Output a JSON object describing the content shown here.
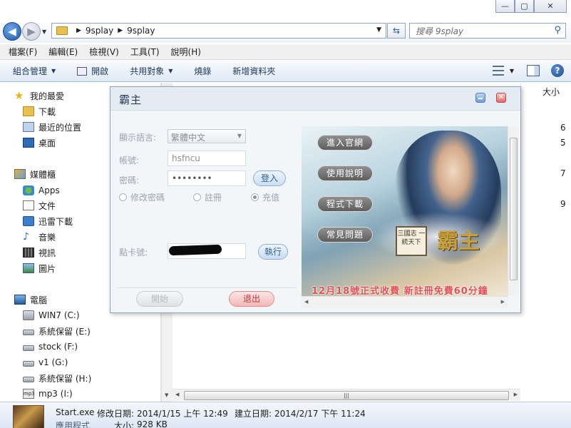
{
  "explorer": {
    "window_buttons": [
      "—",
      "▢",
      "✕"
    ],
    "breadcrumb": [
      "9splay",
      "9splay"
    ],
    "search_placeholder": "搜尋 9splay",
    "menu": [
      "檔案(F)",
      "編輯(E)",
      "檢視(V)",
      "工具(T)",
      "說明(H)"
    ],
    "commands": [
      "組合管理",
      "開啟",
      "共用對象",
      "燒錄",
      "新增資料夾"
    ],
    "column_header": "大小",
    "size_col_cells": [
      "6",
      "5",
      "7",
      "9"
    ],
    "sidebar": {
      "favorites": "我的最愛",
      "fav_items": [
        "下載",
        "最近的位置",
        "桌面"
      ],
      "libraries": "媒體櫃",
      "lib_items": [
        "Apps",
        "文件",
        "迅雷下載",
        "音樂",
        "視訊",
        "圖片"
      ],
      "computer": "電腦",
      "drives": [
        "WIN7 (C:)",
        "系統保留 (E:)",
        "stock (F:)",
        "v1 (G:)",
        "系統保留 (H:)",
        "mp3 (I:)"
      ]
    },
    "details": {
      "name": "Start.exe",
      "modified_label": "修改日期:",
      "modified": "2014/1/15 上午 12:49",
      "created_label": "建立日期:",
      "created": "2014/2/17 下午 11:24",
      "type": "應用程式",
      "size_label": "大小:",
      "size": "928 KB"
    }
  },
  "launcher": {
    "title": "霸主",
    "language_label": "顯示語言:",
    "language_value": "繁體中文",
    "account_label": "帳號:",
    "account_value": "hsfncu",
    "password_label": "密碼:",
    "password_value": "••••••••",
    "login_button": "登入",
    "radio_options": [
      "修改密碼",
      "註冊",
      "充值"
    ],
    "card_label": "點卡號:",
    "execute_button": "執行",
    "start_button": "開始",
    "exit_button": "退出",
    "banner_buttons": [
      "進入官網",
      "使用說明",
      "程式下載",
      "常見問題"
    ],
    "logo_box_text": "三國志 一統天下",
    "logo_title": "霸主",
    "promo_text": "12月18號正式收費  新註冊免費60分鐘"
  }
}
